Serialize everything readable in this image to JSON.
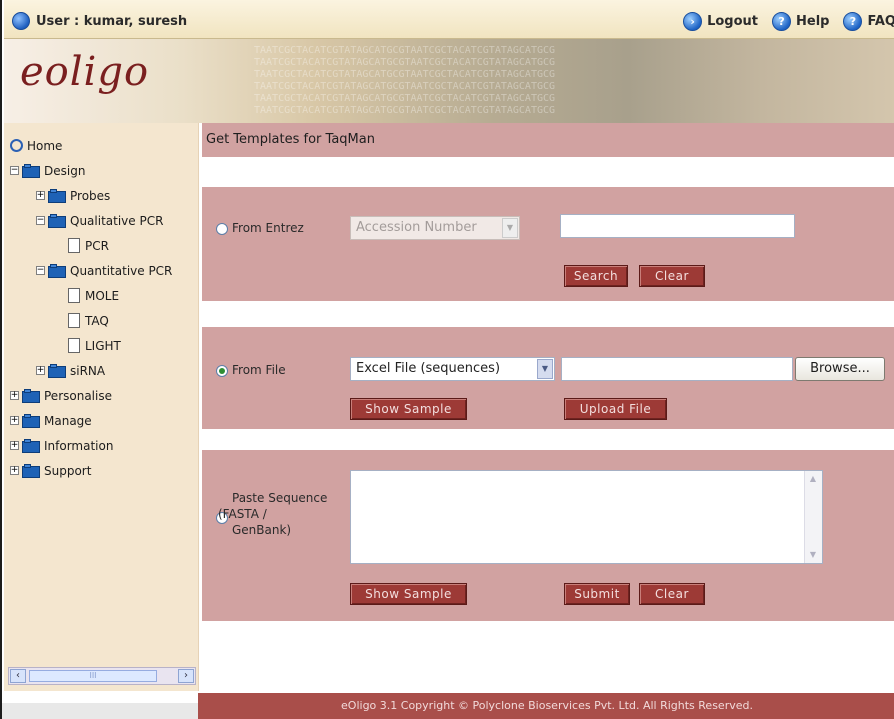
{
  "topbar": {
    "user_label": "User :  kumar, suresh",
    "links": [
      {
        "label": "Logout",
        "icon": "logout-icon"
      },
      {
        "label": "Help",
        "icon": "help-icon"
      },
      {
        "label": "FAQ",
        "icon": "faq-icon"
      }
    ]
  },
  "banner": {
    "logo": "eoligo",
    "dna_text": "TAATCGCTACATCGTATAGCATGCGTAATCGCTACATCGTATAGCATGCG"
  },
  "sidebar": {
    "tree": [
      {
        "label": "Home"
      },
      {
        "label": "Design"
      },
      {
        "label": "Probes"
      },
      {
        "label": "Qualitative PCR"
      },
      {
        "label": "PCR"
      },
      {
        "label": "Quantitative PCR"
      },
      {
        "label": "MOLE"
      },
      {
        "label": "TAQ"
      },
      {
        "label": "LIGHT"
      },
      {
        "label": "siRNA"
      },
      {
        "label": "Personalise"
      },
      {
        "label": "Manage"
      },
      {
        "label": "Information"
      },
      {
        "label": "Support"
      }
    ],
    "scroll_grip": "III"
  },
  "main": {
    "title": "Get Templates for TaqMan",
    "entrez": {
      "label": "From Entrez",
      "select_value": "Accession Number",
      "search_label": "Search",
      "clear_label": "Clear"
    },
    "file": {
      "label": "From File",
      "select_value": "Excel File (sequences)",
      "browse_label": "Browse...",
      "show_sample_label": "Show Sample",
      "upload_label": "Upload File"
    },
    "paste": {
      "label_line1": "Paste Sequence",
      "label_line2": "(FASTA /",
      "label_line3": "GenBank)",
      "show_sample_label": "Show Sample",
      "submit_label": "Submit",
      "clear_label": "Clear"
    }
  },
  "footer": {
    "text": "eOligo 3.1 Copyright © Polyclone Bioservices Pvt. Ltd. All Rights Reserved."
  },
  "colors": {
    "panel": "#d1a2a1",
    "button": "#9d3a36",
    "sidebar": "#f4e6cf",
    "footer": "#a94e4a"
  }
}
